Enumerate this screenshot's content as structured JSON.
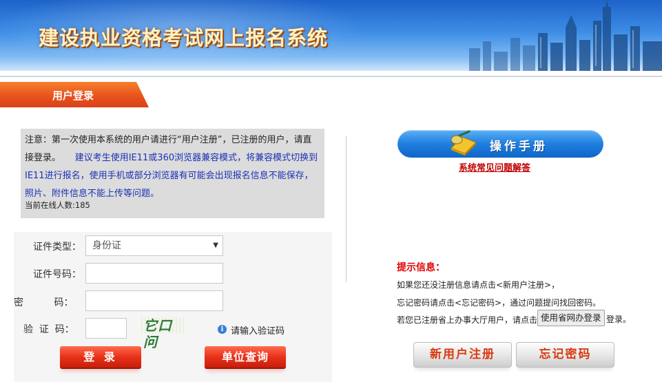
{
  "banner": {
    "title": "建设执业资格考试网上报名系统"
  },
  "section": {
    "login_tab": "用户登录"
  },
  "notice": {
    "line_black": "注意：第一次使用本系统的用户请进行“用户注册”，已注册的用户，请直接登录。",
    "line_blue": "建议考生使用IE11或360浏览器兼容模式，将兼容模式切换到IE11进行报名，使用手机或部分浏览器有可能会出现报名信息不能保存，照片、附件信息不能上传等问题。",
    "online_count": "当前在线人数:185"
  },
  "form": {
    "id_type_label": "证件类型：",
    "id_type_value": "身份证",
    "id_number_label": "证件号码：",
    "password_label": "密          码：",
    "captcha_label": "验  证  码：",
    "captcha_text": "它口问",
    "captcha_hint": "请输入验证码",
    "login_button": "登 录",
    "unit_query_button": "单位查询"
  },
  "right": {
    "manual_button": "操作手册",
    "faq_link": "系统常见问题解答",
    "tip_title": "提示信息：",
    "tip_line1": "如果您还没注册信息请点击<新用户注册>，",
    "tip_line2": "忘记密码请点击<忘记密码>，通过问题提问找回密码。",
    "tip_line3_before": "若您已注册省上办事大厅用户，请点击",
    "gov_login_button": "使用省网办登录",
    "tip_line3_after": "登录。",
    "register_button": "新用户注册",
    "forgot_button": "忘记密码"
  },
  "colors": {
    "banner_blue": "#2a74d6",
    "tab_orange": "#e8501c",
    "login_red": "#e8321a",
    "manual_blue": "#1f7ee0",
    "tip_red": "#e00000",
    "notice_bg": "#dcdcdc"
  }
}
